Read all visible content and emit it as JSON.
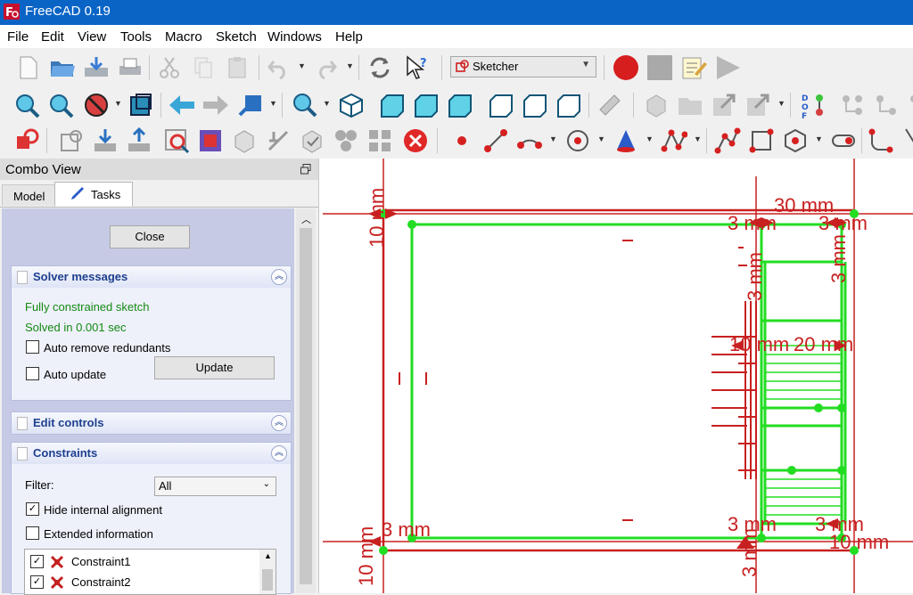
{
  "window": {
    "title": "FreeCAD 0.19",
    "app_icon": "freecad-logo"
  },
  "menu": [
    "File",
    "Edit",
    "View",
    "Tools",
    "Macro",
    "Sketch",
    "Windows",
    "Help"
  ],
  "workbench": {
    "selected": "Sketcher",
    "icon": "sketcher-icon"
  },
  "combo_view": {
    "title": "Combo View",
    "tabs": [
      {
        "label": "Model",
        "active": false
      },
      {
        "label": "Tasks",
        "active": true
      }
    ],
    "close_button": "Close",
    "solver": {
      "title": "Solver messages",
      "status": "Fully constrained sketch",
      "time": "Solved in 0.001 sec",
      "auto_remove": {
        "label": "Auto remove redundants",
        "checked": false
      },
      "auto_update": {
        "label": "Auto update",
        "checked": false
      },
      "update_button": "Update"
    },
    "edit_controls": {
      "title": "Edit controls"
    },
    "constraints": {
      "title": "Constraints",
      "filter_label": "Filter:",
      "filter_value": "All",
      "hide_internal": {
        "label": "Hide internal alignment",
        "checked": true
      },
      "extended_info": {
        "label": "Extended information",
        "checked": false
      },
      "items": [
        {
          "label": "Constraint1",
          "checked": true
        },
        {
          "label": "Constraint2",
          "checked": true
        }
      ]
    }
  },
  "sketch": {
    "dimension_labels": [
      "10 mm",
      "30 mm",
      "3 mm",
      "3 mm",
      "3 mm",
      "3 mm",
      "10 mm",
      "20 mm",
      "3 mm",
      "3 mm",
      "3 mm",
      "10 mm",
      "3 mm",
      "10 mm"
    ],
    "colors": {
      "geometry": "#22dd22",
      "constraints": "#dd2222",
      "canvas": "#ffffff"
    }
  },
  "colors": {
    "titlebar": "#0a64c6",
    "panel": "#c6cae4",
    "group_title": "#1d3f8f",
    "status_green": "#138a13"
  }
}
